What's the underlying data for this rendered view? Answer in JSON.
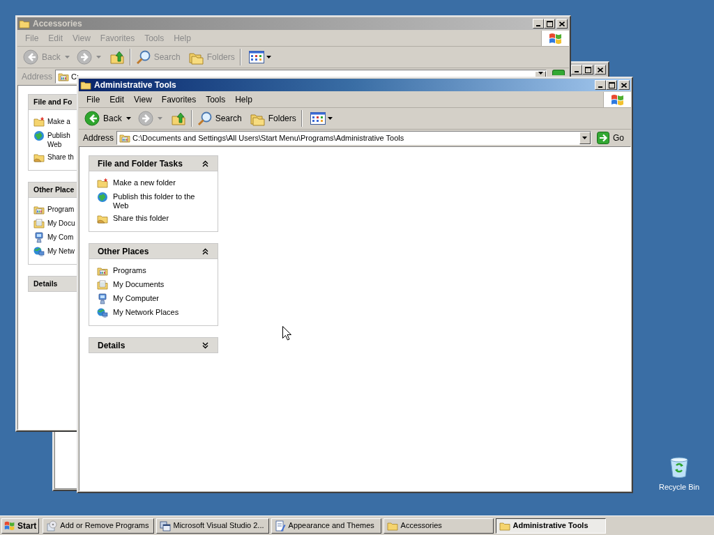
{
  "windows": [
    {
      "kind": "hidden",
      "active": false
    },
    {
      "kind": "explorer",
      "title": "Accessories",
      "active": false,
      "menu": [
        "File",
        "Edit",
        "View",
        "Favorites",
        "Tools",
        "Help"
      ],
      "toolbar": [
        {
          "kind": "back",
          "label": "Back",
          "disabled": true
        },
        {
          "kind": "forward",
          "disabled": true
        },
        {
          "kind": "up"
        },
        {
          "kind": "search",
          "label": "Search"
        },
        {
          "kind": "folders",
          "label": "Folders"
        },
        {
          "kind": "views"
        }
      ],
      "address": {
        "label": "Address",
        "value": "C:"
      },
      "panels": [
        {
          "title": "File and Fo",
          "items": [
            {
              "kind": "new-folder",
              "label": "Make a"
            },
            {
              "kind": "publish",
              "label": "Publish\nWeb"
            },
            {
              "kind": "share",
              "label": "Share th"
            }
          ]
        },
        {
          "title": "Other Place",
          "items": [
            {
              "kind": "programs",
              "label": "Program"
            },
            {
              "kind": "documents",
              "label": "My Docu"
            },
            {
              "kind": "computer",
              "label": "My Com"
            },
            {
              "kind": "network",
              "label": "My Netw"
            }
          ]
        },
        {
          "title": "Details"
        }
      ]
    },
    {
      "kind": "explorer",
      "title": "Administrative Tools",
      "active": true,
      "menu": [
        "File",
        "Edit",
        "View",
        "Favorites",
        "Tools",
        "Help"
      ],
      "toolbar": [
        {
          "kind": "back",
          "label": "Back",
          "disabled": false
        },
        {
          "kind": "forward",
          "disabled": true
        },
        {
          "kind": "up"
        },
        {
          "kind": "search",
          "label": "Search"
        },
        {
          "kind": "folders",
          "label": "Folders"
        },
        {
          "kind": "views"
        }
      ],
      "address": {
        "label": "Address",
        "value": "C:\\Documents and Settings\\All Users\\Start Menu\\Programs\\Administrative Tools",
        "go": "Go"
      },
      "panels": [
        {
          "title": "File and Folder Tasks",
          "expanded": true,
          "items": [
            {
              "kind": "new-folder",
              "label": "Make a new folder"
            },
            {
              "kind": "publish",
              "label": "Publish this folder to the Web"
            },
            {
              "kind": "share",
              "label": "Share this folder"
            }
          ]
        },
        {
          "title": "Other Places",
          "expanded": true,
          "items": [
            {
              "kind": "programs",
              "label": "Programs"
            },
            {
              "kind": "documents",
              "label": "My Documents"
            },
            {
              "kind": "computer",
              "label": "My Computer"
            },
            {
              "kind": "network",
              "label": "My Network Places"
            }
          ]
        },
        {
          "title": "Details",
          "expanded": false
        }
      ]
    }
  ],
  "desktop_icons": [
    {
      "label": "Recycle Bin"
    }
  ],
  "taskbar": {
    "start": "Start",
    "tasks": [
      {
        "kind": "programs-disc",
        "label": "Add or Remove Programs",
        "selected": false
      },
      {
        "kind": "studio",
        "label": "Microsoft Visual Studio 2...",
        "selected": false
      },
      {
        "kind": "themes",
        "label": "Appearance and Themes",
        "selected": false
      },
      {
        "kind": "folder",
        "label": "Accessories",
        "selected": false
      },
      {
        "kind": "folder",
        "label": "Administrative Tools",
        "selected": true
      }
    ]
  }
}
